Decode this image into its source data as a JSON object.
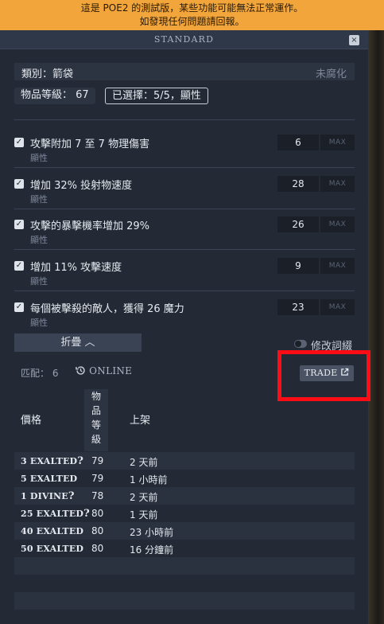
{
  "banner": {
    "line1": "這是 POE2 的測試版，某些功能可能無法正常運作。",
    "line2": "如發現任何問題請回報。"
  },
  "window": {
    "title": "STANDARD",
    "close_glyph": "×"
  },
  "item": {
    "category": "類別：箭袋",
    "status": "未腐化",
    "item_level": "物品等級： 67",
    "selected": "已選擇：5/5，顯性"
  },
  "mods": [
    {
      "text": "攻擊附加 7 至 7 物理傷害",
      "type": "顯性",
      "value": "6",
      "max_label": "MAX"
    },
    {
      "text": "增加 32% 投射物速度",
      "type": "顯性",
      "value": "28",
      "max_label": "MAX"
    },
    {
      "text": "攻擊的暴擊機率增加 29%",
      "type": "顯性",
      "value": "26",
      "max_label": "MAX"
    },
    {
      "text": "增加 11% 攻擊速度",
      "type": "顯性",
      "value": "9",
      "max_label": "MAX"
    },
    {
      "text": "每個被擊殺的敵人，獲得 26 魔力",
      "type": "顯性",
      "value": "23",
      "max_label": "MAX"
    }
  ],
  "controls": {
    "collapse_label": "折疊 ︿",
    "edit_mods_label": "修改詞綴",
    "match_count": "匹配： 6",
    "online_label": "ONLINE",
    "trade_label": "TRADE"
  },
  "results": {
    "headers": {
      "price": "價格",
      "item_level": [
        "物",
        "品",
        "等",
        "級"
      ],
      "listed": "上架"
    },
    "rows": [
      {
        "price": "3 EXALTED",
        "uncertain": "?",
        "ilvl": "79",
        "listed": "2 天前"
      },
      {
        "price": "5 EXALTED",
        "uncertain": "",
        "ilvl": "79",
        "listed": "1 小時前"
      },
      {
        "price": "1 DIVINE",
        "uncertain": "?",
        "ilvl": "78",
        "listed": "2 天前"
      },
      {
        "price": "25 EXALTED",
        "uncertain": "?",
        "ilvl": "80",
        "listed": "1 天前"
      },
      {
        "price": "40 EXALTED",
        "uncertain": "",
        "ilvl": "80",
        "listed": "23 小時前"
      },
      {
        "price": "50 EXALTED",
        "uncertain": "",
        "ilvl": "80",
        "listed": "16 分鐘前"
      }
    ]
  }
}
